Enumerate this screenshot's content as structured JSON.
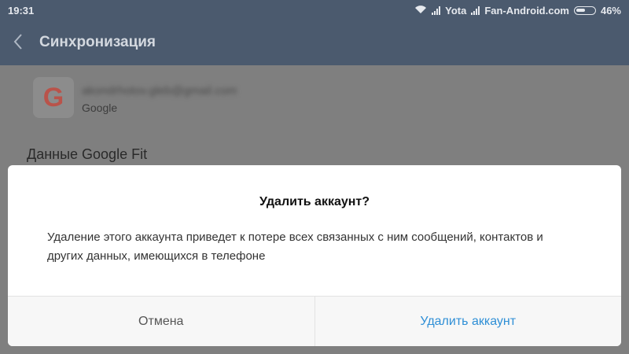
{
  "statusbar": {
    "time": "19:31",
    "carrier1": "Yota",
    "carrier2": "Fan-Android.com",
    "battery": "46%"
  },
  "actionbar": {
    "title": "Синхронизация",
    "back_icon": "chevron-left-icon"
  },
  "account": {
    "email": "akondrhotov.gleb@gmail.com",
    "provider": "Google",
    "logo_icon": "google-g-icon"
  },
  "sync_items": [
    "Данные Google Fit"
  ],
  "dialog": {
    "title": "Удалить аккаунт?",
    "message": "Удаление этого аккаунта приведет к потере всех связанных с ним сообщений, контактов и других данных, имеющихся в телефоне",
    "cancel_label": "Отмена",
    "confirm_label": "Удалить аккаунт"
  },
  "colors": {
    "header_bg": "#4b5a6e",
    "confirm_text": "#2f8fd6"
  }
}
